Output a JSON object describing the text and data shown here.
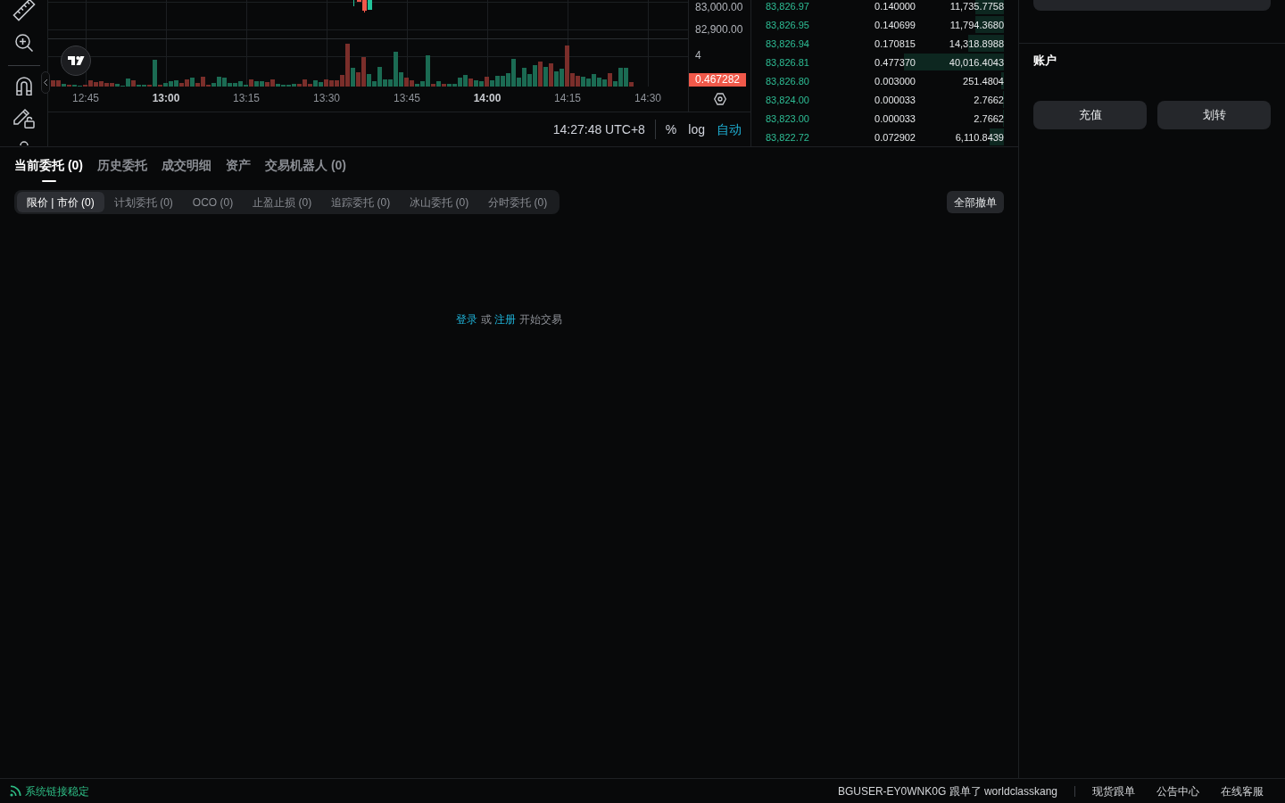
{
  "chart": {
    "price_labels": [
      "83,000.00",
      "82,900.00"
    ],
    "volume_label": "4",
    "last_volume": "0.467282",
    "time_labels": [
      {
        "text": "12:45",
        "major": false
      },
      {
        "text": "13:00",
        "major": true
      },
      {
        "text": "13:15",
        "major": false
      },
      {
        "text": "13:30",
        "major": false
      },
      {
        "text": "13:45",
        "major": false
      },
      {
        "text": "14:00",
        "major": true
      },
      {
        "text": "14:15",
        "major": false
      },
      {
        "text": "14:30",
        "major": false
      }
    ],
    "clock": "14:27:48 UTC+8",
    "scale_options": [
      {
        "label": "%",
        "selected": false
      },
      {
        "label": "log",
        "selected": false
      },
      {
        "label": "自动",
        "selected": true
      }
    ]
  },
  "order_book": {
    "rows": [
      {
        "price": "83,826.97",
        "amount": "0.140000",
        "total": "11,735.7758",
        "level": 0.12
      },
      {
        "price": "83,826.95",
        "amount": "0.140699",
        "total": "11,794.3680",
        "level": 0.12
      },
      {
        "price": "83,826.94",
        "amount": "0.170815",
        "total": "14,318.8988",
        "level": 0.15
      },
      {
        "price": "83,826.81",
        "amount": "0.477370",
        "total": "40,016.4043",
        "level": 0.42
      },
      {
        "price": "83,826.80",
        "amount": "0.003000",
        "total": "251.4804",
        "level": 0.01
      },
      {
        "price": "83,824.00",
        "amount": "0.000033",
        "total": "2.7662",
        "level": 0.004
      },
      {
        "price": "83,823.00",
        "amount": "0.000033",
        "total": "2.7662",
        "level": 0.004
      },
      {
        "price": "83,822.72",
        "amount": "0.072902",
        "total": "6,110.8439",
        "level": 0.06
      }
    ]
  },
  "account": {
    "title": "账户",
    "buttons": [
      "充值",
      "划转"
    ]
  },
  "orders": {
    "tabs": [
      {
        "label": "当前委托 (0)",
        "selected": true
      },
      {
        "label": "历史委托",
        "selected": false
      },
      {
        "label": "成交明细",
        "selected": false
      },
      {
        "label": "资产",
        "selected": false
      },
      {
        "label": "交易机器人 (0)",
        "selected": false
      }
    ],
    "filters": [
      {
        "label": "限价 | 市价 (0)",
        "selected": true
      },
      {
        "label": "计划委托 (0)",
        "selected": false
      },
      {
        "label": "OCO (0)",
        "selected": false
      },
      {
        "label": "止盈止损 (0)",
        "selected": false
      },
      {
        "label": "追踪委托 (0)",
        "selected": false
      },
      {
        "label": "冰山委托 (0)",
        "selected": false
      },
      {
        "label": "分时委托 (0)",
        "selected": false
      }
    ],
    "cancel_all": "全部撤单",
    "empty_message": [
      {
        "kind": "link",
        "text": "登录"
      },
      {
        "kind": "text",
        "text": "或"
      },
      {
        "kind": "link",
        "text": "注册"
      },
      {
        "kind": "text",
        "text": "开始交易"
      }
    ]
  },
  "status_bar": {
    "connection": "系统链接稳定",
    "notice": "BGUSER-EY0WNK0G 跟单了 worldclasskang",
    "links": [
      "现货跟单",
      "公告中心",
      "在线客服"
    ]
  }
}
